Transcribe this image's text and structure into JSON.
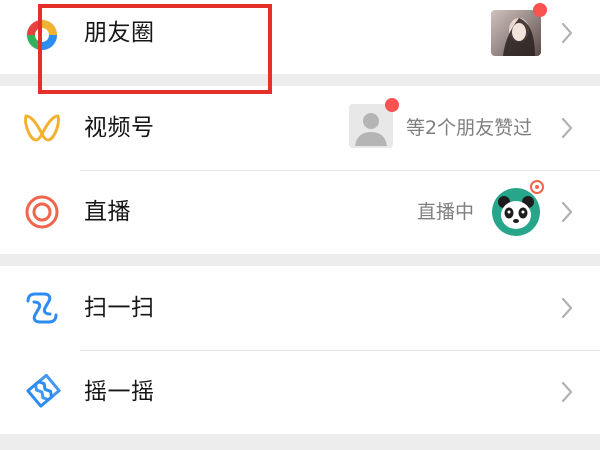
{
  "items": [
    {
      "label": "朋友圈",
      "icon": "moments-icon"
    },
    {
      "label": "视频号",
      "icon": "channels-icon",
      "side_text": "等2个朋友赞过"
    },
    {
      "label": "直播",
      "icon": "live-icon",
      "side_text": "直播中"
    },
    {
      "label": "扫一扫",
      "icon": "scan-icon"
    },
    {
      "label": "摇一摇",
      "icon": "shake-icon"
    }
  ],
  "colors": {
    "background": "#ededed",
    "card": "#ffffff",
    "badge": "#fa5151",
    "highlight": "#e5302a",
    "live_accent": "#f0654b",
    "channels_accent": "#f3b130",
    "scan_accent": "#2d8cf0"
  }
}
